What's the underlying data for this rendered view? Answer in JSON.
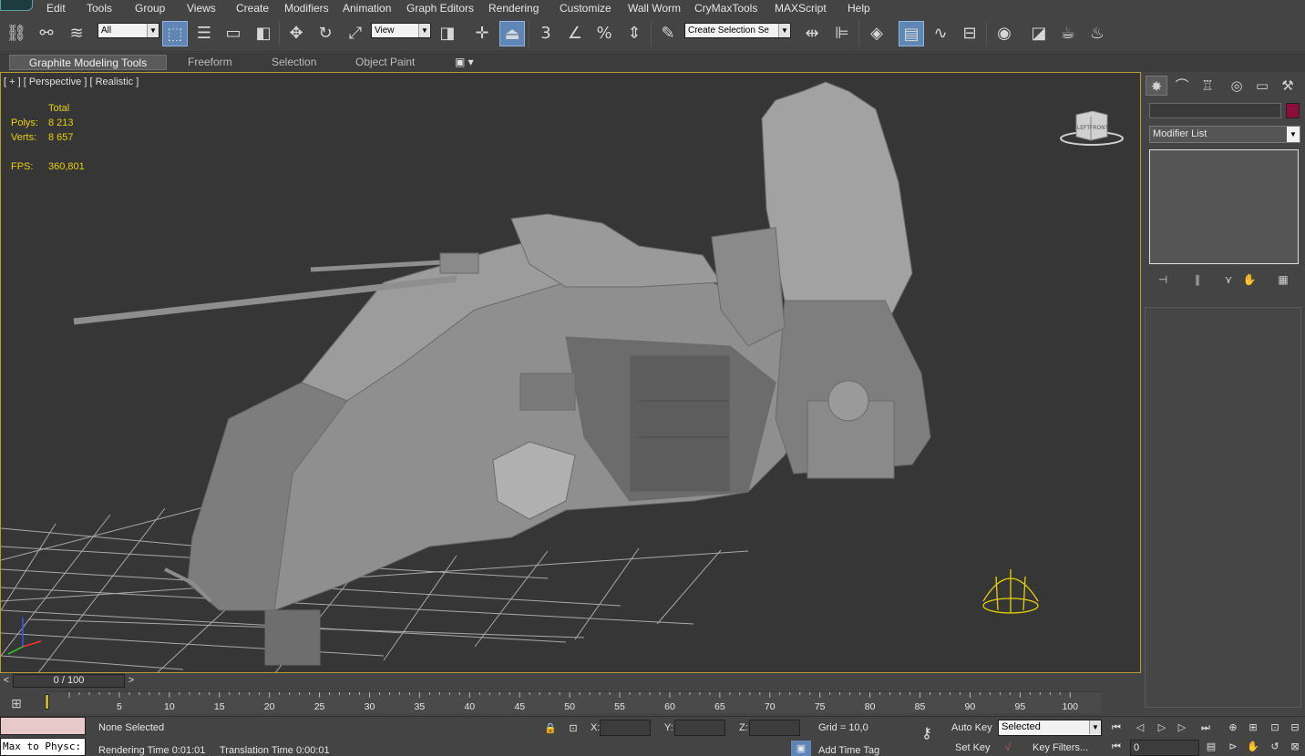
{
  "menu": [
    "Edit",
    "Tools",
    "Group",
    "Views",
    "Create",
    "Modifiers",
    "Animation",
    "Graph Editors",
    "Rendering",
    "Customize",
    "Wall Worm",
    "CryMaxTools",
    "MAXScript",
    "Help"
  ],
  "toolbar": {
    "selection_filter": "All",
    "reference_coord": "View",
    "named_selection_placeholder": "Create Selection Se",
    "snap_labels": {
      "snap3": "3",
      "percent": "%"
    }
  },
  "ribbon": {
    "tabs": [
      "Graphite Modeling Tools",
      "Freeform",
      "Selection",
      "Object Paint"
    ]
  },
  "viewport": {
    "label": "[ + ] [ Perspective ] [ Realistic ]",
    "stats": {
      "total_label": "Total",
      "polys_label": "Polys:",
      "polys_value": "8 213",
      "verts_label": "Verts:",
      "verts_value": "8 657",
      "fps_label": "FPS:",
      "fps_value": "360,801"
    },
    "viewcube": {
      "left": "LEFT",
      "front": "FRONT"
    },
    "axis": {
      "x": "x",
      "y": "y",
      "z": "z"
    }
  },
  "command_panel": {
    "tabs": [
      "create-icon",
      "modify-icon",
      "hierarchy-icon",
      "motion-icon",
      "display-icon",
      "utilities-icon"
    ],
    "object_color": "#8c0d3a",
    "modifier_list": "Modifier List"
  },
  "time_slider": {
    "value": "0 / 100",
    "prev": "<",
    "next": ">"
  },
  "track_ticks": [
    5,
    10,
    15,
    20,
    25,
    30,
    35,
    40,
    45,
    50,
    55,
    60,
    65,
    70,
    75,
    80,
    85,
    90,
    95,
    100
  ],
  "status": {
    "selection": "None Selected",
    "rendering_time": "Rendering Time  0:01:01",
    "translation_time": "Translation Time  0:00:01",
    "x_label": "X:",
    "y_label": "Y:",
    "z_label": "Z:",
    "grid": "Grid = 10,0",
    "add_time_tag": "Add Time Tag",
    "auto_key": "Auto Key",
    "set_key": "Set Key",
    "key_mode": "Selected",
    "key_filters": "Key Filters...",
    "current_frame": "0",
    "listener_text": "Max to Physc:"
  },
  "colors": {
    "viewport_border": "#b89b32",
    "stats_text": "#e8d200",
    "active_tool": "#5f86b5",
    "key_marker": "#c8b423"
  }
}
